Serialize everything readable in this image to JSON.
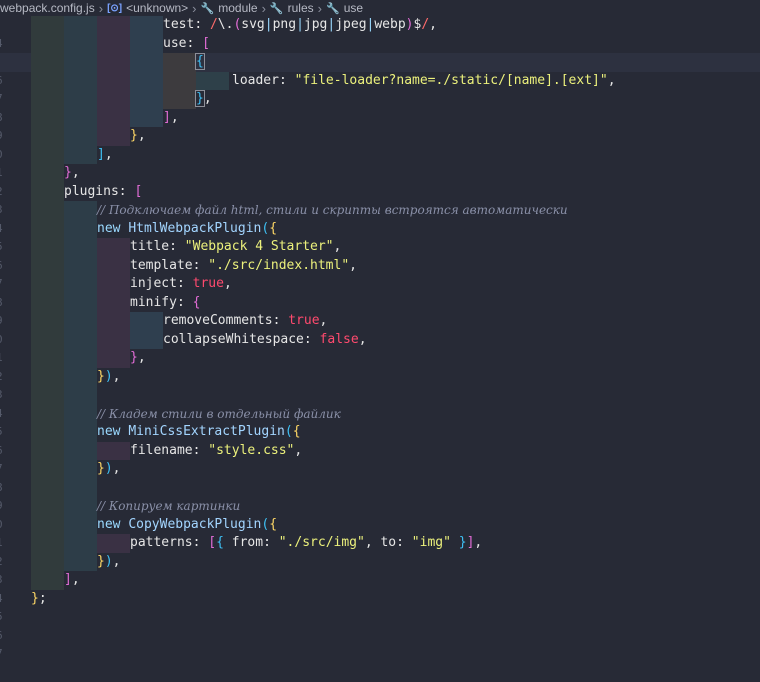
{
  "breadcrumb": {
    "file": "webpack.config.js",
    "items": [
      "<unknown>",
      "module",
      "rules",
      "use"
    ]
  },
  "line_numbers": [
    "4",
    "5",
    "6",
    "7",
    "8",
    "9",
    "0",
    "1",
    "2",
    "3",
    "4",
    "5",
    "6",
    "7",
    "8",
    "9",
    "0",
    "1",
    "2",
    "3",
    "4",
    "5",
    "6",
    "7",
    "8",
    "9",
    "0",
    "1",
    "2",
    "3",
    "4",
    "5",
    "6",
    "7"
  ],
  "code": {
    "test_key": "test",
    "use_key": "use",
    "loader_key": "loader",
    "loader_value": "\"file-loader?name=./static/[name].[ext]\"",
    "plugins_key": "plugins",
    "comment_1": "// Подключаем файл html, стили и скрипты встроятся автоматически",
    "new_kw": "new",
    "html_plugin": "HtmlWebpackPlugin",
    "title_key": "title",
    "title_value": "\"Webpack 4 Starter\"",
    "template_key": "template",
    "template_value": "\"./src/index.html\"",
    "inject_key": "inject",
    "true_kw": "true",
    "false_kw": "false",
    "minify_key": "minify",
    "remove_comments_key": "removeComments",
    "collapse_whitespace_key": "collapseWhitespace",
    "comment_2": "// Кладем стили в отдельный файлик",
    "css_plugin": "MiniCssExtractPlugin",
    "filename_key": "filename",
    "filename_value": "\"style.css\"",
    "comment_3": "// Копируем картинки",
    "copy_plugin": "CopyWebpackPlugin",
    "patterns_key": "patterns",
    "from_key": "from",
    "from_value": "\"./src/img\"",
    "to_key": "to",
    "to_value": "\"img\""
  }
}
